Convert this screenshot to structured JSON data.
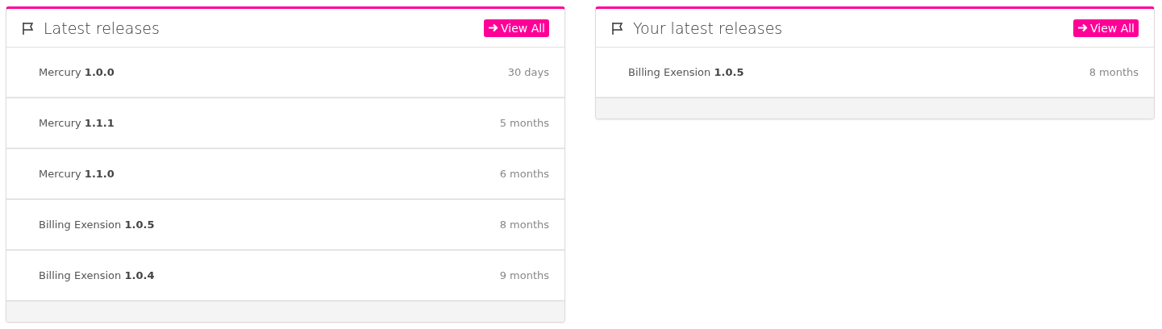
{
  "panels": [
    {
      "title": "Latest releases",
      "button": "View All",
      "releases": [
        {
          "name": "Mercury **1.0.0**",
          "age": "30 days"
        },
        {
          "name": "Mercury **1.1.1**",
          "age": "5 months"
        },
        {
          "name": "Mercury **1.1.0**",
          "age": "6 months"
        },
        {
          "name": "Billing Exension **1.0.5**",
          "age": "8 months"
        },
        {
          "name": "Billing Exension **1.0.4**",
          "age": "9 months"
        }
      ]
    },
    {
      "title": "Your latest releases",
      "button": "View All",
      "releases": [
        {
          "name": "Billing Exension **1.0.5**",
          "age": "8 months"
        }
      ]
    }
  ]
}
